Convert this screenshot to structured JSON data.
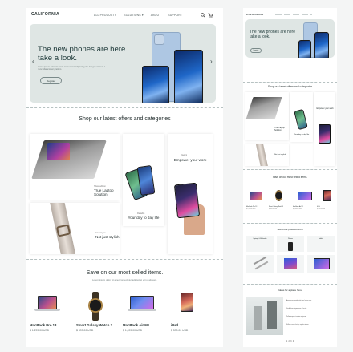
{
  "main": {
    "brand": "CALIFORNIA",
    "nav": [
      "ALL PRODUCTS",
      "SOLUTIONS ▾",
      "ABOUT",
      "SUPPORT"
    ],
    "hero": {
      "title": "The new phones are here take a look.",
      "subtitle": "Lorem ipsum dolor sit amet, consectetur adipiscing elit. Integer ut lorem a nunc ullamcorper pretium.",
      "button": "Register",
      "prev": "‹",
      "next": "›"
    },
    "offers": {
      "title": "Shop our latest offers and categories",
      "cards": [
        {
          "tag": "Silver edition",
          "title": "True Laptop Solution"
        },
        {
          "tag": "Xiaomi",
          "title": "Empower your work"
        },
        {
          "tag": "Reliable",
          "title": "Your day to day life"
        },
        {
          "tag": "Cool styles",
          "title": "Not just stylish"
        }
      ]
    },
    "saved": {
      "title": "Save on our most selled items.",
      "subtitle": "Lorem ipsum dolor sit amet consectetur adipiscing elit ut aliquam.",
      "products": [
        {
          "name": "MacBook Pro 13",
          "price": "$ 1,299.00 USD",
          "icon": "laptop-icon"
        },
        {
          "name": "Smart Galaxy Watch 3",
          "price": "$ 399.00 USD",
          "icon": "watch-icon"
        },
        {
          "name": "MacBook Air M1",
          "price": "$ 1,099.00 USD",
          "icon": "laptop-icon"
        },
        {
          "name": "iPad",
          "price": "$ 599.00 USD",
          "icon": "tablet-icon"
        }
      ]
    }
  },
  "side": {
    "brand": "CALIFORNIA",
    "hero_title": "The new phones are here take a look.",
    "hero_button": "Register",
    "offers_title": "Shop our latest offers and categories",
    "offer_labels": [
      "True Laptop Solution",
      "Empower your work",
      "Your day to day life",
      "Not just stylish"
    ],
    "saved_title": "Save on our most selled items.",
    "saved_products": [
      "MacBook Pro 13",
      "Smart Galaxy Watch 3",
      "MacBook Air M1",
      "iPad"
    ],
    "saved_prices": [
      "$ 1,299.00 USD",
      "$ 399.00 USD",
      "$ 1,099.00 USD",
      "$ 599.00 USD"
    ],
    "browse_title": "See more products from",
    "browse_items": [
      "Laptops & Macbooks",
      "Phones",
      "Tablets",
      "Accessories",
      "Headphones",
      "Desktop"
    ],
    "ideas_title": "Ideas for a place here",
    "ideas_lines": [
      "Aenean nec faucibus dui, nec luctus nunc.",
      "Vestibulum aliquam eros at lectus.",
      "Pellentesque ut sapien vel ipsum.",
      "Nullam a nunc luctus, sagittis mi non."
    ],
    "pagination": "1  2  3  4"
  },
  "colors": {
    "page_bg": "#f4f5f5",
    "hero_bg": "#dfe6e4",
    "text": "#1f2a2a"
  }
}
